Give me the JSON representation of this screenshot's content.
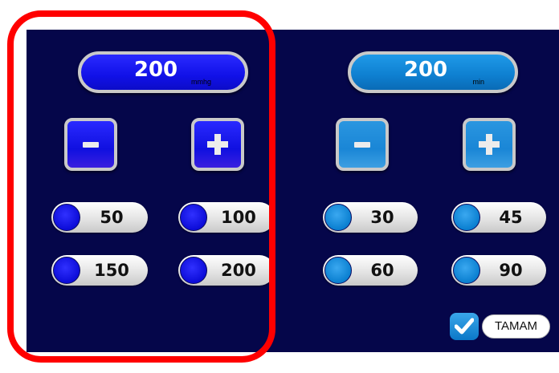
{
  "pressure_panel": {
    "display": {
      "value": "200",
      "unit": "mmhg"
    },
    "minus_label": "-",
    "plus_label": "+",
    "presets": [
      "50",
      "100",
      "150",
      "200"
    ]
  },
  "time_panel": {
    "display": {
      "value": "200",
      "unit": "min"
    },
    "minus_label": "-",
    "plus_label": "+",
    "presets": [
      "30",
      "45",
      "60",
      "90"
    ]
  },
  "confirm": {
    "label": "TAMAM",
    "icon": "check-icon",
    "checked": true
  },
  "colors": {
    "panel_bg": "#05064a",
    "pressure_blue": "#1111e8",
    "time_blue": "#0e7fd0",
    "highlight_red": "#ff0000"
  }
}
